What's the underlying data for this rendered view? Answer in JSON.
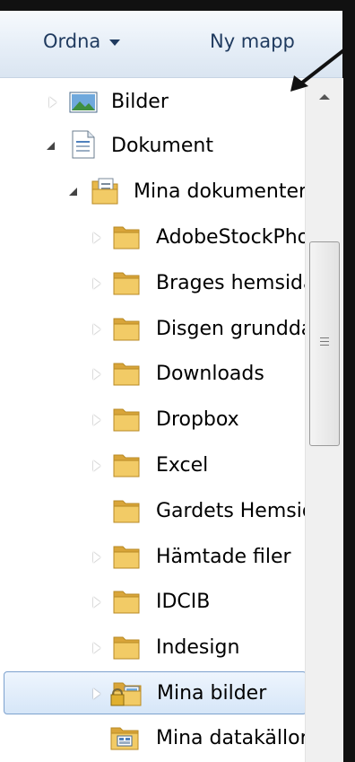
{
  "toolbar": {
    "organize_label": "Ordna",
    "new_folder_label": "Ny mapp"
  },
  "tree": [
    {
      "label": "Bilder",
      "icon": "pictures-library-icon",
      "expander": "collapsed"
    },
    {
      "label": "Dokument",
      "icon": "documents-library-icon",
      "expander": "expanded"
    },
    {
      "label": "Mina dokumenter",
      "icon": "documents-folder-icon",
      "expander": "expanded"
    },
    {
      "label": "AdobeStockPhotos",
      "icon": "folder-icon",
      "expander": "collapsed"
    },
    {
      "label": "Brages hemsida",
      "icon": "folder-icon",
      "expander": "collapsed"
    },
    {
      "label": "Disgen grunddata",
      "icon": "folder-icon",
      "expander": "collapsed"
    },
    {
      "label": "Downloads",
      "icon": "folder-icon",
      "expander": "collapsed"
    },
    {
      "label": "Dropbox",
      "icon": "folder-icon",
      "expander": "collapsed"
    },
    {
      "label": "Excel",
      "icon": "folder-icon",
      "expander": "collapsed"
    },
    {
      "label": "Gardets Hemsida",
      "icon": "folder-icon",
      "expander": "none"
    },
    {
      "label": "Hämtade filer",
      "icon": "folder-icon",
      "expander": "collapsed"
    },
    {
      "label": "IDCIB",
      "icon": "folder-icon",
      "expander": "collapsed"
    },
    {
      "label": "Indesign",
      "icon": "folder-icon",
      "expander": "collapsed"
    },
    {
      "label": "Mina bilder",
      "icon": "locked-pictures-folder-icon",
      "expander": "collapsed",
      "selected": true
    },
    {
      "label": "Mina datakällor",
      "icon": "data-sources-folder-icon",
      "expander": "none"
    }
  ],
  "colors": {
    "toolbar_text": "#1f3a5f",
    "selection_border": "#7da2ce",
    "folder": "#e8b84a"
  }
}
